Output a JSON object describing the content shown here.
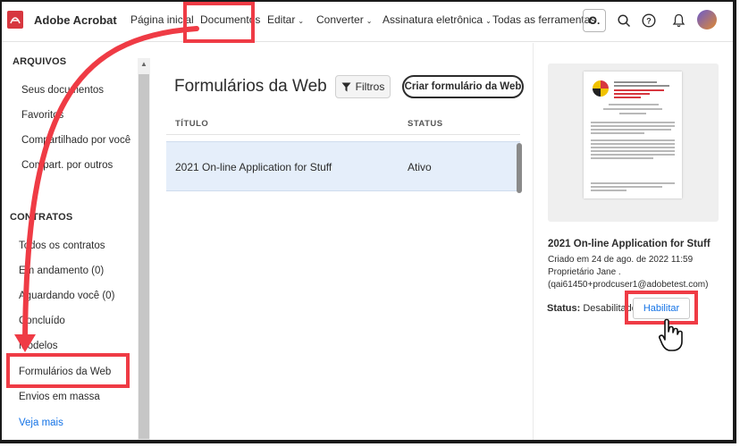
{
  "app": {
    "name": "Adobe Acrobat",
    "brand_color": "#d7373f"
  },
  "topnav": {
    "items": [
      {
        "label": "Página inicial",
        "dropdown": false
      },
      {
        "label": "Documentos",
        "dropdown": false
      },
      {
        "label": "Editar",
        "dropdown": true
      },
      {
        "label": "Converter",
        "dropdown": true
      },
      {
        "label": "Assinatura eletrônica",
        "dropdown": true
      },
      {
        "label": "Todas as ferramentas",
        "dropdown": false
      }
    ],
    "org_initial": "O.",
    "icons": [
      "search-icon",
      "help-icon",
      "bell-icon",
      "avatar"
    ]
  },
  "sidebar": {
    "files_heading": "ARQUIVOS",
    "files": [
      "Seus documentos",
      "Favoritos",
      "Compartilhado por você",
      "Compart. por outros"
    ],
    "contracts_heading": "CONTRATOS",
    "contracts": [
      "Todos os contratos",
      "Em andamento (0)",
      "Aguardando você (0)",
      "Concluído",
      "Modelos",
      "Formulários da Web",
      "Envios em massa"
    ],
    "see_more": "Veja mais"
  },
  "main": {
    "title": "Formulários da Web",
    "filter_label": "Filtros",
    "create_label": "Criar formulário da Web",
    "columns": {
      "title": "TÍTULO",
      "status": "STATUS"
    },
    "rows": [
      {
        "title": "2021 On-line Application for Stuff",
        "status": "Ativo",
        "selected": true
      }
    ]
  },
  "details": {
    "title": "2021 On-line Application for Stuff",
    "created": "Criado em 24 de ago. de 2022 11:59",
    "owner": "Proprietário Jane .",
    "email": "(qai61450+prodcuser1@adobetest.com)",
    "status_label": "Status:",
    "status_value": "Desabilitado",
    "enable_label": "Habilitar",
    "accent": "#1473e6"
  },
  "annotation_color": "#ef3b45"
}
